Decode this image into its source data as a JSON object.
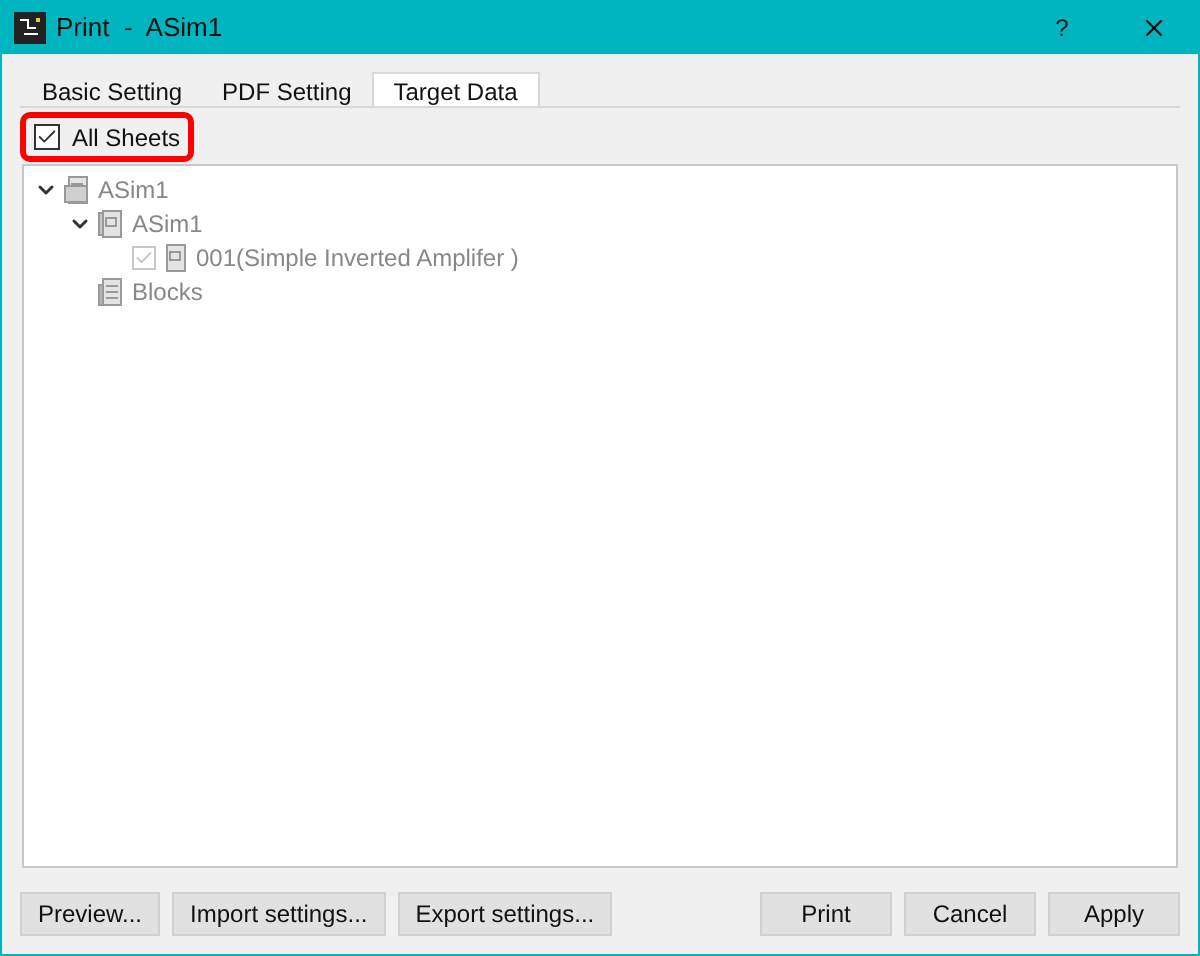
{
  "window": {
    "title": "Print  -  ASim1",
    "help": "?"
  },
  "tabs": [
    {
      "label": "Basic Setting",
      "selected": false
    },
    {
      "label": "PDF Setting",
      "selected": false
    },
    {
      "label": "Target Data",
      "selected": true
    }
  ],
  "all_sheets": {
    "label": "All Sheets",
    "checked": true,
    "highlighted": true
  },
  "tree": [
    {
      "label": "ASim1",
      "kind": "project",
      "expanded": true,
      "children": [
        {
          "label": "ASim1",
          "kind": "sheet-group",
          "expanded": true,
          "children": [
            {
              "label": "001(Simple Inverted Amplifer )",
              "kind": "sheet",
              "checked": true
            }
          ]
        },
        {
          "label": "Blocks",
          "kind": "blocks"
        }
      ]
    }
  ],
  "buttons_left": [
    "Preview...",
    "Import settings...",
    "Export settings..."
  ],
  "buttons_right": [
    "Print",
    "Cancel",
    "Apply"
  ]
}
